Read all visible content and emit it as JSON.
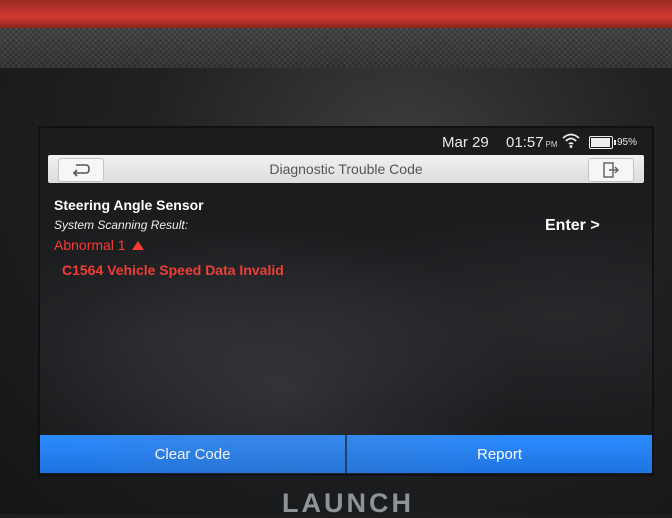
{
  "status_bar": {
    "date": "Mar 29",
    "time": "01:57",
    "ampm": "PM",
    "battery": "95%",
    "icons": [
      "wifi-icon",
      "battery-icon"
    ]
  },
  "header": {
    "title": "Diagnostic Trouble Code",
    "icons": [
      "back-arrow-icon",
      "exit-icon"
    ]
  },
  "result": {
    "system_name": "Steering Angle Sensor",
    "scan_label": "System Scanning Result:",
    "enter_label": "Enter >",
    "abnormal_label": "Abnormal 1",
    "warning_icon": "triangle-up-icon",
    "codes": [
      {
        "text": "C1564 Vehicle Speed Data Invalid"
      }
    ]
  },
  "actions": {
    "clear_code": "Clear Code",
    "report": "Report"
  },
  "device": {
    "brand": "LAUNCH"
  },
  "colors": {
    "accent_blue": "#1e74e0",
    "fault_red": "#ff3a30",
    "title_bar": "#e6e6e6"
  }
}
